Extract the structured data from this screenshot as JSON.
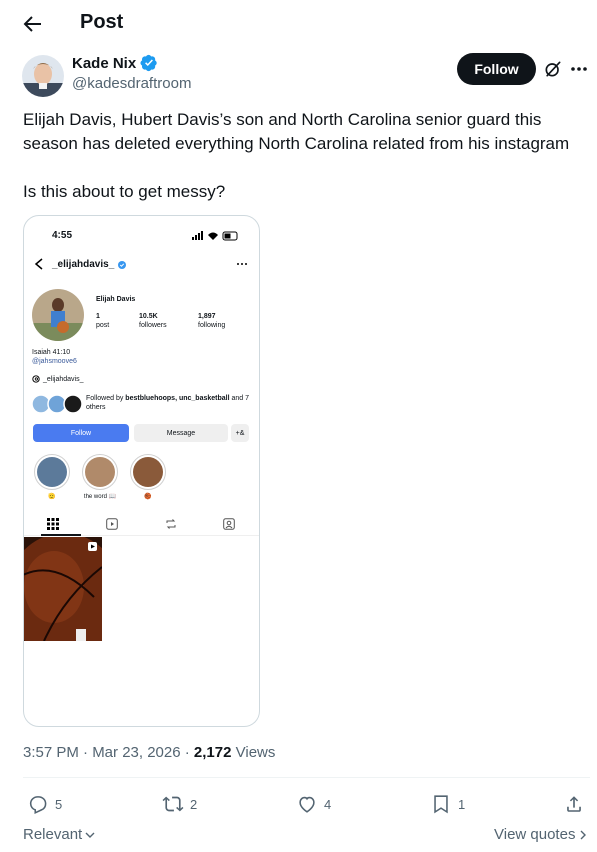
{
  "header": {
    "title": "Post"
  },
  "author": {
    "name": "Kade Nix",
    "handle": "@kadesdraftroom",
    "follow_label": "Follow"
  },
  "post": {
    "text_line1": "Elijah Davis, Hubert Davis’s son and North Carolina senior guard this season has deleted everything North Carolina related from his instagram",
    "text_line2": "Is this about to get messy?"
  },
  "media": {
    "time": "4:55",
    "username": "_elijahdavis_",
    "display_name": "Elijah Davis",
    "stats": [
      {
        "num": "1",
        "label": "post"
      },
      {
        "num": "10.5K",
        "label": "followers"
      },
      {
        "num": "1,897",
        "label": "following"
      }
    ],
    "bio_line": "Isaiah 41:10",
    "bio_mention": "@jahsmoove6",
    "threads_handle": "_elijahdavis_",
    "followed_by_prefix": "Followed by ",
    "followed_by_names": "bestbluehoops, unc_basketball",
    "followed_by_suffix": "and 7 others",
    "follow_btn": "Follow",
    "message_btn": "Message",
    "add_user_btn": "+&",
    "highlights": [
      {
        "label": "🫡"
      },
      {
        "label": "the word 📖"
      },
      {
        "label": "🏀"
      }
    ]
  },
  "meta": {
    "time_date": "3:57 PM · Mar 23, 2026 · ",
    "views_count": "2,172",
    "views_label": " Views"
  },
  "actions": {
    "replies": "5",
    "reposts": "2",
    "likes": "4",
    "bookmarks": "1"
  },
  "footer": {
    "sort_label": "Relevant",
    "view_quotes": "View quotes"
  },
  "colors": {
    "accent": "#1d9bf0",
    "text": "#0f1419",
    "muted": "#536471",
    "ig_blue": "#4a7bf0"
  }
}
